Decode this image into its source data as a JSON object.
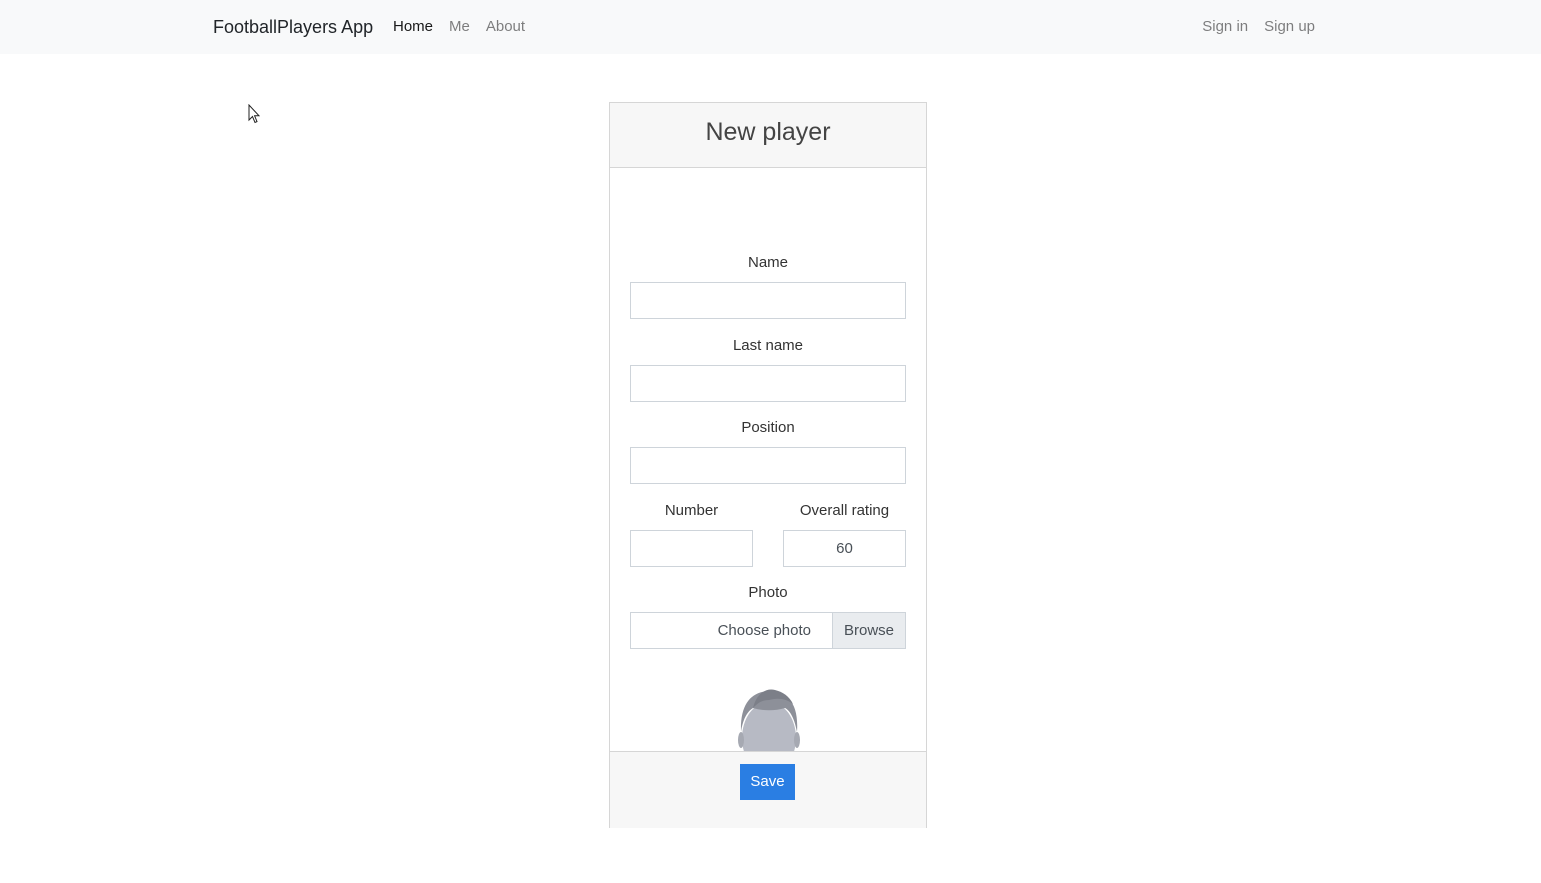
{
  "navbar": {
    "brand": "FootballPlayers App",
    "left_items": [
      {
        "label": "Home",
        "active": true
      },
      {
        "label": "Me",
        "active": false
      },
      {
        "label": "About",
        "active": false
      }
    ],
    "right_items": [
      {
        "label": "Sign in"
      },
      {
        "label": "Sign up"
      }
    ]
  },
  "form": {
    "title": "New player",
    "name": {
      "label": "Name",
      "value": ""
    },
    "last_name": {
      "label": "Last name",
      "value": ""
    },
    "position": {
      "label": "Position",
      "value": ""
    },
    "number": {
      "label": "Number",
      "value": ""
    },
    "overall_rating": {
      "label": "Overall rating",
      "value": "60"
    },
    "photo": {
      "label": "Photo",
      "placeholder": "Choose photo",
      "browse_label": "Browse"
    },
    "avatar_icon": "default-player-avatar-icon",
    "save_label": "Save"
  },
  "colors": {
    "navbar_bg": "#f8f9fa",
    "card_header_bg": "#f7f7f7",
    "primary": "#2a7ee3",
    "browse_bg": "#e9ecef"
  }
}
